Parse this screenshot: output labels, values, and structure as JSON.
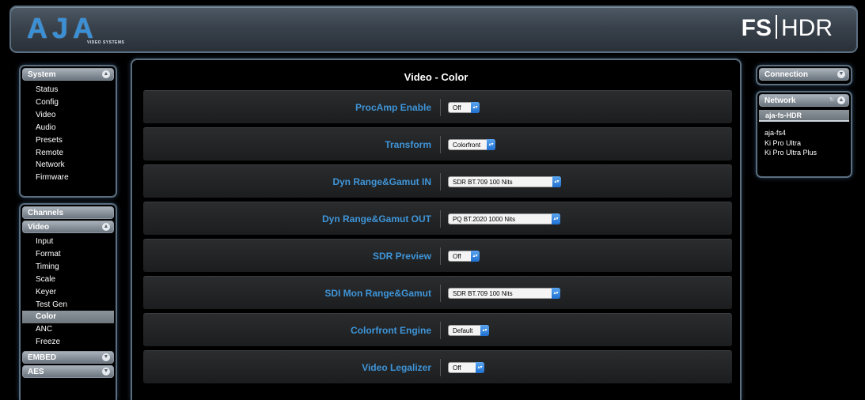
{
  "brand": {
    "logo": "AJA",
    "logo_sub": "VIDEO SYSTEMS",
    "product_left": "FS",
    "product_right": "HDR"
  },
  "nav": {
    "system": {
      "title": "System",
      "items": [
        "Status",
        "Config",
        "Video",
        "Audio",
        "Presets",
        "Remote",
        "Network",
        "Firmware"
      ]
    },
    "channels": {
      "title": "Channels"
    },
    "video": {
      "title": "Video",
      "items": [
        "Input",
        "Format",
        "Timing",
        "Scale",
        "Keyer",
        "Test Gen",
        "Color",
        "ANC",
        "Freeze"
      ],
      "active": "Color"
    },
    "embed": {
      "title": "EMBED"
    },
    "aes": {
      "title": "AES"
    }
  },
  "main": {
    "title": "Video - Color",
    "rows": [
      {
        "label": "ProcAmp Enable",
        "value": "Off"
      },
      {
        "label": "Transform",
        "value": "Colorfront"
      },
      {
        "label": "Dyn Range&Gamut IN",
        "value": "SDR BT.709 100 Nits"
      },
      {
        "label": "Dyn Range&Gamut OUT",
        "value": "PQ BT.2020 1000 Nits"
      },
      {
        "label": "SDR Preview",
        "value": "Off"
      },
      {
        "label": "SDI Mon Range&Gamut",
        "value": "SDR BT.709 100 Nits"
      },
      {
        "label": "Colorfront Engine",
        "value": "Default"
      },
      {
        "label": "Video Legalizer",
        "value": "Off"
      }
    ]
  },
  "right": {
    "connection": {
      "title": "Connection"
    },
    "network": {
      "title": "Network",
      "selected": "aja-fs-HDR",
      "hosts": [
        "aja-fs4",
        "Ki Pro Ultra",
        "Ki Pro Ultra Plus"
      ]
    }
  },
  "colors": {
    "accent_blue": "#3f95d8",
    "logo_blue": "#3b8fd4",
    "select_arrow": "#1f6fd0",
    "panel_border": "#5a6e80"
  }
}
